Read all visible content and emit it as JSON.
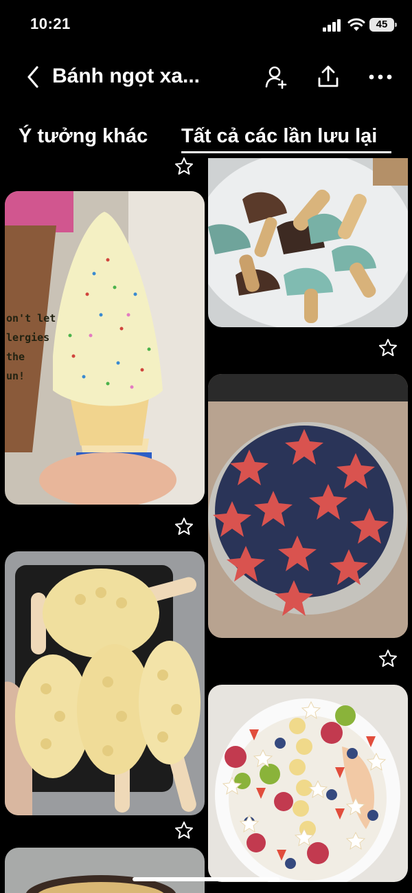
{
  "status_bar": {
    "time": "10:21",
    "battery": "45"
  },
  "header": {
    "title": "Bánh ngọt xa..."
  },
  "tabs": [
    {
      "label": "Ý tưởng khác",
      "active": false
    },
    {
      "label": "Tất cả các lần lưu lại",
      "active": true
    }
  ],
  "pins": [
    {
      "name": "pin-ice-cream-cone",
      "subject": "sprinkle soft-serve ice cream cone"
    },
    {
      "name": "pin-mushroom-cookies",
      "subject": "chocolate mushroom cookies on plate"
    },
    {
      "name": "pin-watermelon-stars",
      "subject": "watermelon stars and blueberries bowl"
    },
    {
      "name": "pin-durian-popsicles",
      "subject": "durian-shaped ice cream bars"
    },
    {
      "name": "pin-fruit-bowl",
      "subject": "fruit bowl with berries, kiwi, banana"
    },
    {
      "name": "pin-partial",
      "subject": "partially visible pin"
    }
  ],
  "colors": {
    "background": "#000000",
    "text": "#ffffff"
  }
}
